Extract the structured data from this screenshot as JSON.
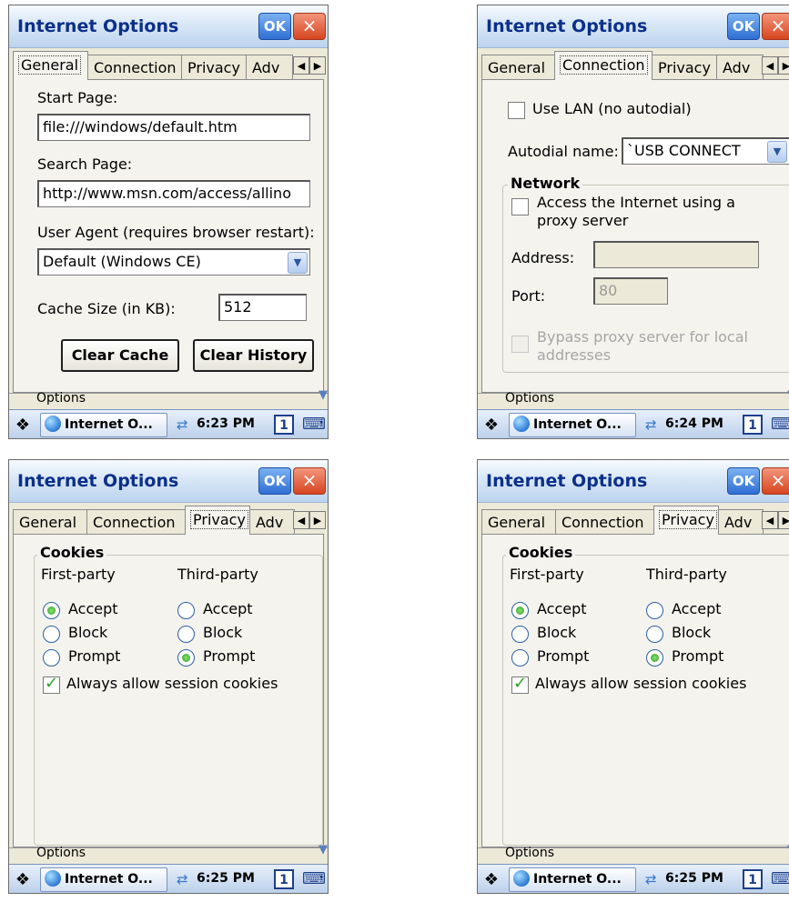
{
  "screens": [
    {
      "title": "Internet Options",
      "ok": "OK",
      "close": "×",
      "tabs": [
        "General",
        "Connection",
        "Privacy",
        "Adv"
      ],
      "active_tab": "General",
      "start_page_label": "Start Page:",
      "start_page_value": "file:///windows/default.htm",
      "search_page_label": "Search Page:",
      "search_page_value": "http://www.msn.com/access/allino",
      "user_agent_label": "User Agent (requires browser restart):",
      "user_agent_value": "Default (Windows CE)",
      "cache_size_label": "Cache Size (in KB):",
      "cache_size_value": "512",
      "clear_cache": "Clear Cache",
      "clear_history": "Clear History",
      "options_label": "Options",
      "taskbar_app": "Internet O...",
      "clock": "6:23 PM",
      "input_panel": "1"
    },
    {
      "title": "Internet Options",
      "ok": "OK",
      "close": "×",
      "tabs": [
        "General",
        "Connection",
        "Privacy",
        "Adv"
      ],
      "active_tab": "Connection",
      "use_lan_label": "Use LAN (no autodial)",
      "autodial_label": "Autodial name:",
      "autodial_value": "`USB CONNECT",
      "network_title": "Network",
      "proxy_label_1": "Access the Internet using a",
      "proxy_label_2": "proxy server",
      "address_label": "Address:",
      "address_value": "",
      "port_label": "Port:",
      "port_value": "80",
      "bypass_label_1": "Bypass proxy server for local",
      "bypass_label_2": "addresses",
      "options_label": "Options",
      "taskbar_app": "Internet O...",
      "clock": "6:24 PM",
      "input_panel": "1"
    },
    {
      "title": "Internet Options",
      "ok": "OK",
      "close": "×",
      "tabs": [
        "General",
        "Connection",
        "Privacy",
        "Adv"
      ],
      "active_tab": "Privacy",
      "cookies_title": "Cookies",
      "first_party": "First-party",
      "third_party": "Third-party",
      "accept": "Accept",
      "block": "Block",
      "prompt": "Prompt",
      "first_selected": "Accept",
      "third_selected": "Prompt",
      "session_cookies": "Always allow session cookies",
      "options_label": "Options",
      "taskbar_app": "Internet O...",
      "clock": "6:25 PM",
      "input_panel": "1"
    },
    {
      "title": "Internet Options",
      "ok": "OK",
      "close": "×",
      "tabs": [
        "General",
        "Connection",
        "Privacy",
        "Adv"
      ],
      "active_tab": "Privacy",
      "cookies_title": "Cookies",
      "first_party": "First-party",
      "third_party": "Third-party",
      "accept": "Accept",
      "block": "Block",
      "prompt": "Prompt",
      "first_selected": "Accept",
      "third_selected": "Prompt",
      "session_cookies": "Always allow session cookies",
      "options_label": "Options",
      "taskbar_app": "Internet O...",
      "clock": "6:25 PM",
      "input_panel": "1"
    }
  ],
  "colors": {
    "title_text": "#0b2f8a",
    "dialog_bg": "#ece9d8",
    "radio_selected": "#2a9b2a",
    "checkmark": "#2aa12a"
  },
  "icons": {
    "start": "windows-flag-icon",
    "app": "internet-explorer-globe-icon",
    "tray": "network-connection-icon",
    "keyboard": "input-panel-keyboard-icon"
  }
}
